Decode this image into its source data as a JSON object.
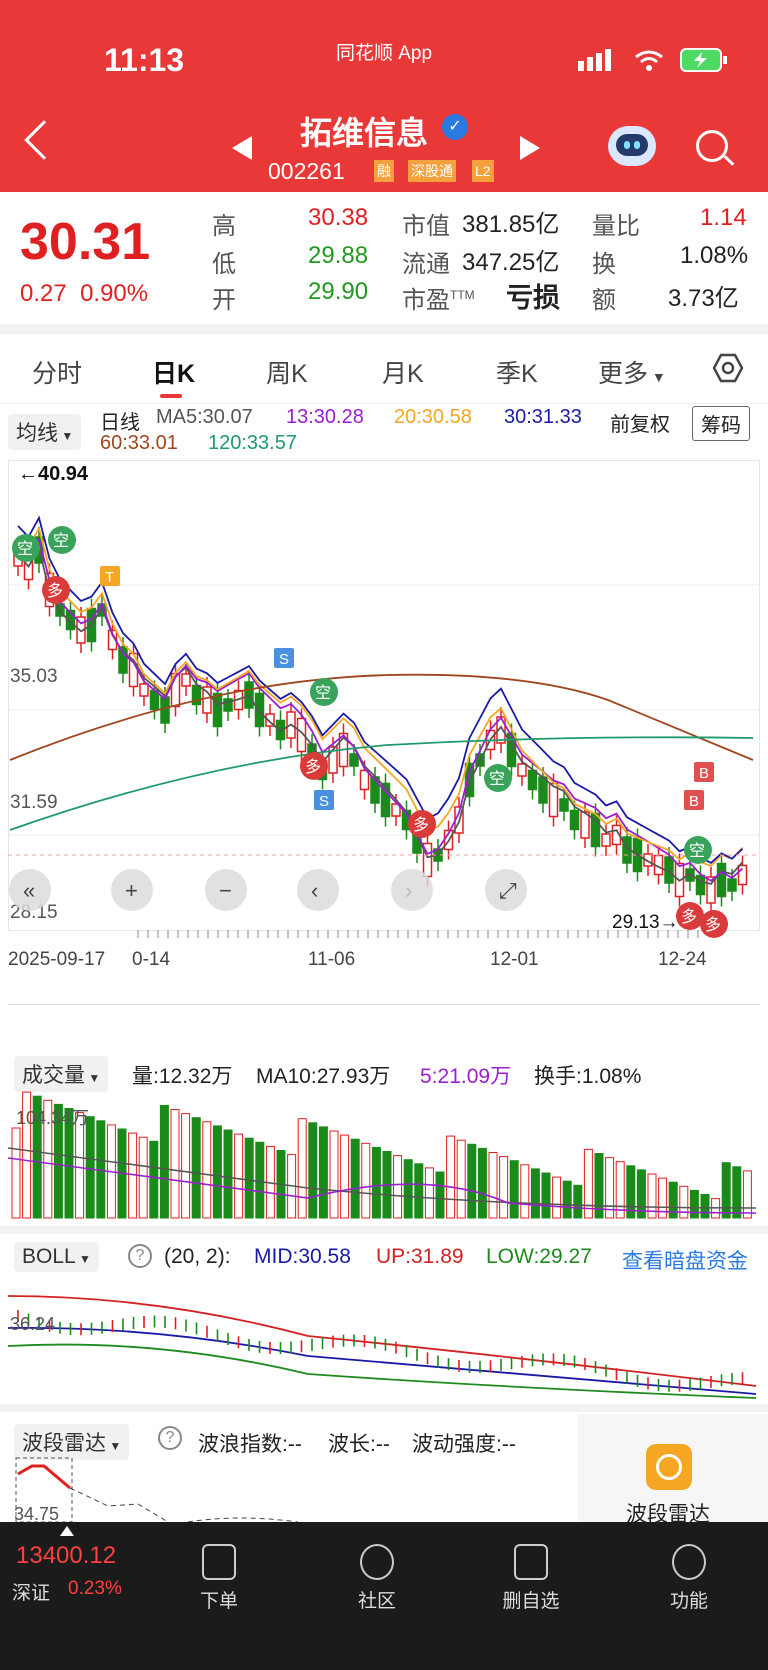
{
  "status_bar": {
    "time": "11:13",
    "app": "同花顺 App"
  },
  "header": {
    "name": "拓维信息",
    "code": "002261",
    "tags": [
      "融",
      "深股通",
      "L2"
    ]
  },
  "quote": {
    "price": "30.31",
    "change": "0.27",
    "change_pct": "0.90%",
    "high_label": "高",
    "high": "30.38",
    "low_label": "低",
    "low": "29.88",
    "open_label": "开",
    "open": "29.90",
    "mktcap_label": "市值",
    "mktcap": "381.85亿",
    "float_label": "流通",
    "float": "347.25亿",
    "pe_label": "市盈",
    "pe_sup": "TTM",
    "pe": "亏损",
    "vr_label": "量比",
    "vr": "1.14",
    "turnover_label": "换",
    "turnover": "1.08%",
    "amount_label": "额",
    "amount": "3.73亿"
  },
  "tabs": [
    "分时",
    "日K",
    "周K",
    "月K",
    "季K",
    "更多"
  ],
  "ma": {
    "selector": "均线",
    "period": "日线",
    "ma5": "MA5:30.07",
    "ma13": "13:30.28",
    "ma20": "20:30.58",
    "ma30": "30:31.33",
    "ma60": "60:33.01",
    "ma120": "120:33.57",
    "adjust": "前复权",
    "chip": "筹码",
    "colors": {
      "ma5": "#555555",
      "ma13": "#9b1fd1",
      "ma20": "#f5a623",
      "ma30": "#1a1aa8",
      "ma60": "#a0461e",
      "ma120": "#1f9a6a"
    }
  },
  "kline": {
    "y_ticks": [
      "35.03",
      "31.59",
      "28.15"
    ],
    "y_top": "41.9",
    "max_label": "←40.94",
    "min_label": "29.13→",
    "dates": [
      "2025-09-17",
      "0-14",
      "11-06",
      "12-01",
      "12-24"
    ],
    "markers": {
      "kong": "空",
      "duo": "多",
      "s": "S",
      "t": "T",
      "b": "B"
    }
  },
  "volume": {
    "selector": "成交量",
    "vol": "量:12.32万",
    "ma10": "MA10:27.93万",
    "ma5": "5:21.09万",
    "turnover": "换手:1.08%",
    "scale": "104.34万"
  },
  "boll": {
    "selector": "BOLL",
    "params": "(20, 2):",
    "mid": "MID:30.58",
    "up": "UP:31.89",
    "low": "LOW:29.27",
    "link": "查看暗盘资金",
    "scale": "36.24"
  },
  "wave": {
    "selector": "波段雷达",
    "index": "波浪指数:--",
    "length": "波长:--",
    "strength": "波动强度:--",
    "scale": "34.75",
    "side_label": "波段雷达"
  },
  "bottom": {
    "index_value": "13400.12",
    "index_name": "深证",
    "index_pct": "0.23%",
    "items": [
      "下单",
      "社区",
      "删自选",
      "功能"
    ]
  }
}
